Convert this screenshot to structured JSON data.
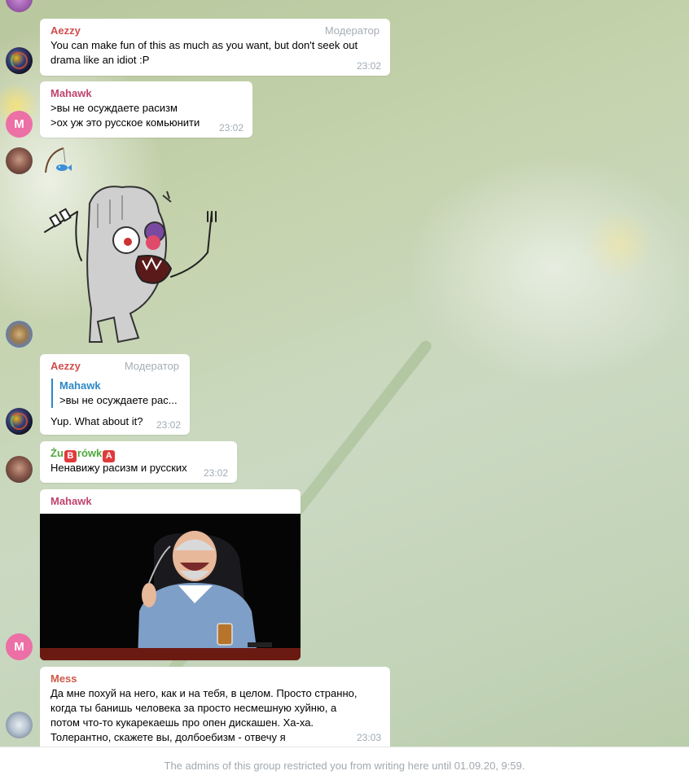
{
  "messages": [
    {
      "sender": "Aezzy",
      "role": "Модератор",
      "text_lines": [
        "You can make fun of this as much as you want, but don't seek out",
        "drama like an idiot :P"
      ],
      "time": "23:02"
    },
    {
      "sender": "Mahawk",
      "avatar_letter": "M",
      "text_lines": [
        ">вы не осуждаете расизм",
        ">ох уж это русское комьюнити"
      ],
      "time": "23:02"
    },
    {
      "sender": "Aezzy",
      "role": "Модератор",
      "reply_to": {
        "sender": "Mahawk",
        "text": ">вы не осуждаете рас..."
      },
      "text": "Yup. What about it?",
      "time": "23:02"
    },
    {
      "sender_parts": [
        "Żu",
        "B",
        "rówk",
        "A"
      ],
      "text": "Ненавижу расизм и русских",
      "time": "23:02"
    },
    {
      "sender": "Mahawk",
      "avatar_letter": "M",
      "media": "video-thumbnail"
    },
    {
      "sender": "Mess",
      "text_lines": [
        "Да мне похуй на него, как и на тебя, в целом. Просто странно,",
        "когда ты банишь человека за просто несмешную хуйню, а",
        "потом что-то кукарекаешь про опен дискашен. Ха-ха.",
        "Толерантно, скажете вы, долбоебизм - отвечу я"
      ],
      "time": "23:03"
    }
  ],
  "footer": {
    "restriction_text": "The admins of this group restricted you from writing here until 01.09.20, 9:59."
  },
  "icons": [
    "sticker-zombie-icon",
    "fishing-emoji-icon",
    "laughing-man-video"
  ],
  "colors": {
    "aezzy_name": "#d14e4e",
    "mahawk_name": "#c0436b",
    "mess_name": "#cc5a4a",
    "reply_name": "#2d88c7",
    "zub_name": "#4fa83d",
    "badge": "#e03b3b",
    "avatar_m": "#ec6fa6",
    "time": "#a0acb6"
  }
}
